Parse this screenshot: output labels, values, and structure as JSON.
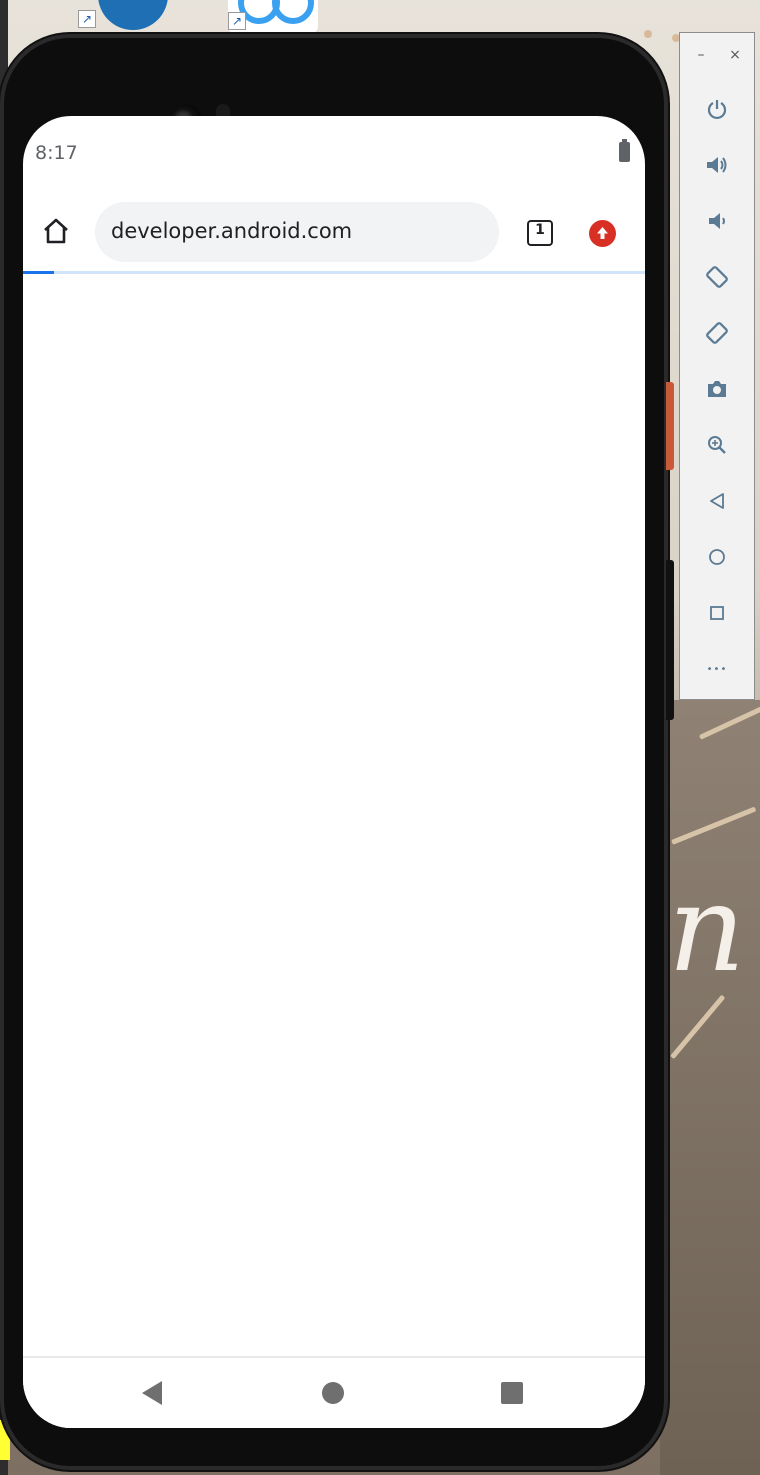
{
  "browser": {
    "url_text": "developer.android.com",
    "tab_count": "1",
    "load_progress_percent": 5
  },
  "status_bar": {
    "time": "8:17"
  },
  "colors": {
    "accent": "#1a73e8",
    "update_badge": "#d93025",
    "omnibox_bg": "#f1f3f4",
    "emulator_icon": "#5b7a93"
  },
  "icons": {
    "toolbar": [
      "home-icon",
      "tab-switcher-icon",
      "update-available-icon"
    ],
    "nav_bar": [
      "back-icon",
      "home-circle-icon",
      "recents-icon"
    ],
    "emulator_panel": [
      "minimize-icon",
      "close-icon",
      "power-icon",
      "volume-up-icon",
      "volume-down-icon",
      "rotate-left-icon",
      "rotate-right-icon",
      "camera-icon",
      "zoom-icon",
      "back-icon",
      "home-icon",
      "overview-icon",
      "more-icon"
    ]
  },
  "emulator": {
    "minimize_glyph": "–",
    "close_glyph": "×",
    "more_glyph": "•••"
  }
}
